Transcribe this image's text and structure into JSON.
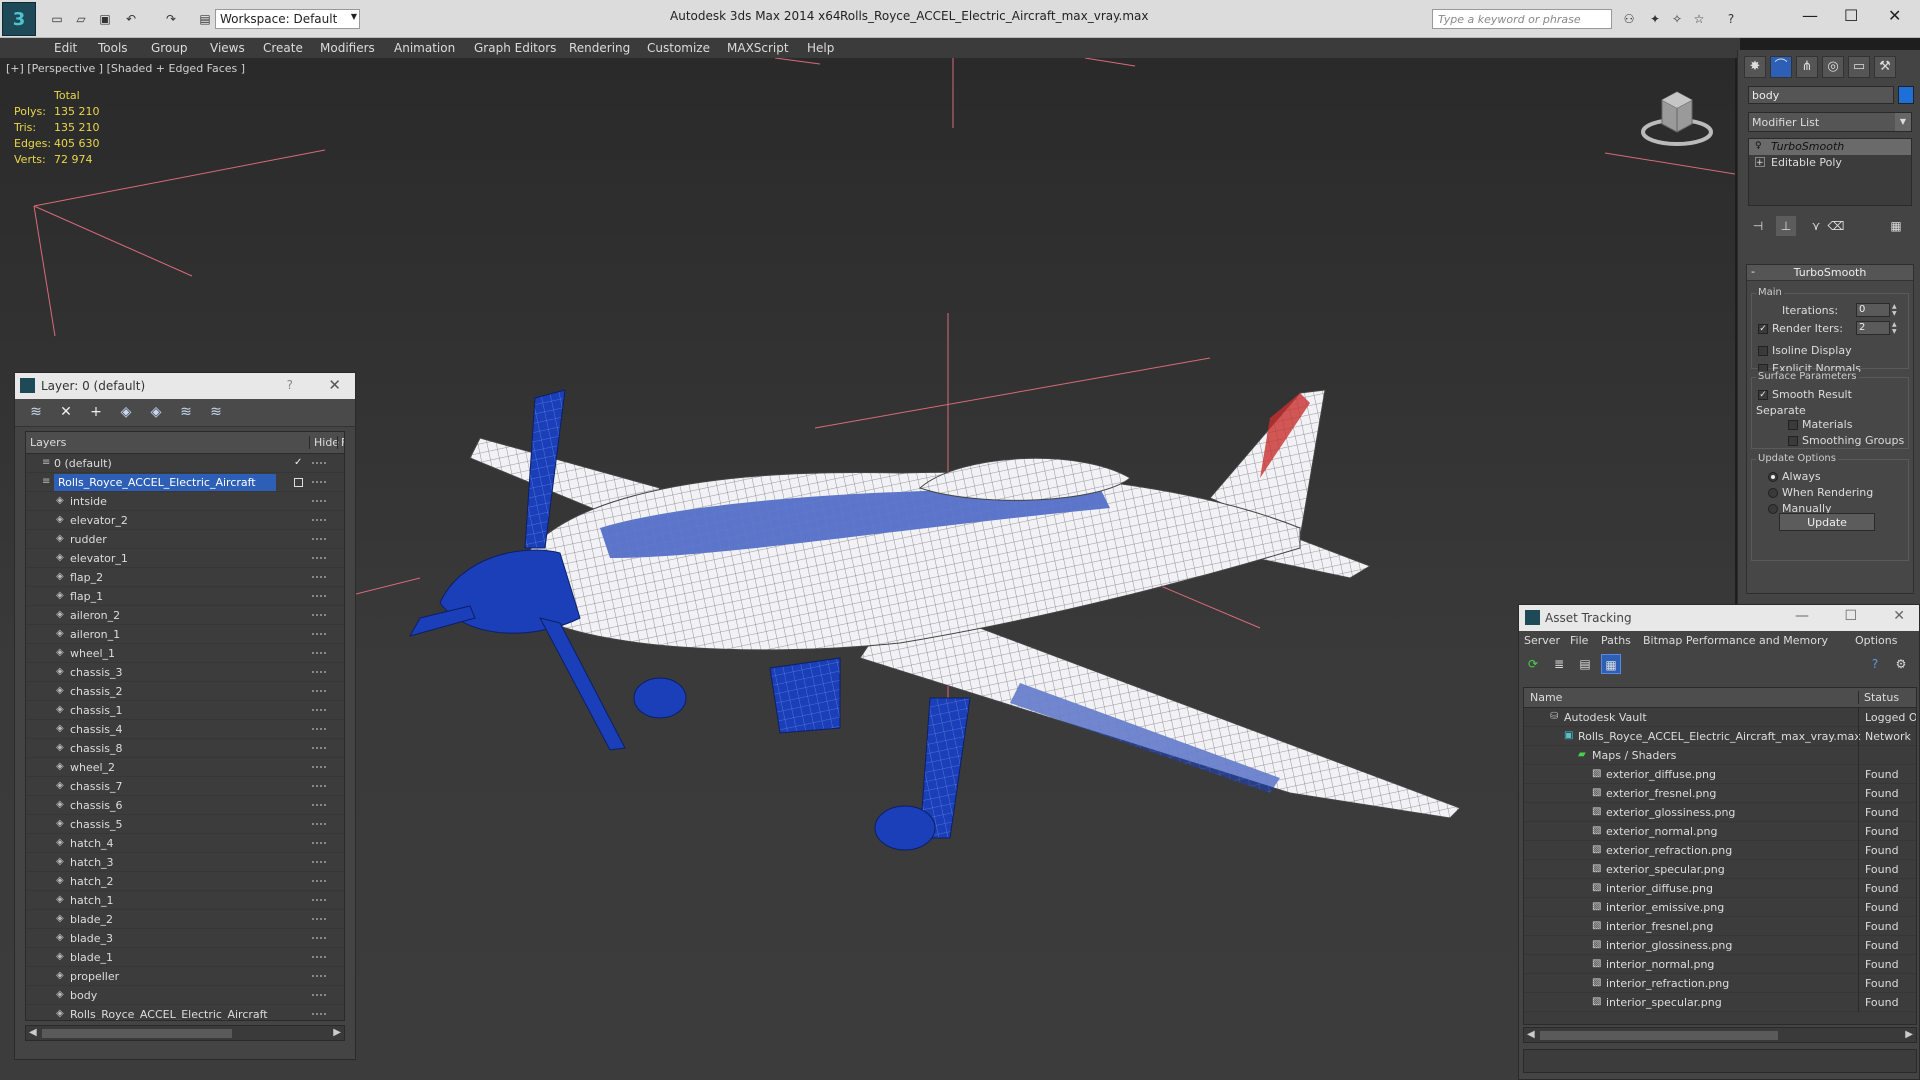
{
  "app": {
    "title": "Autodesk 3ds Max  2014 x64",
    "file_name": "Rolls_Royce_ACCEL_Electric_Aircraft_max_vray.max",
    "workspace": "Workspace: Default",
    "search_placeholder": "Type a keyword or phrase",
    "logo_glyph": "3"
  },
  "menu": [
    "Edit",
    "Tools",
    "Group",
    "Views",
    "Create",
    "Modifiers",
    "Animation",
    "Graph Editors",
    "Rendering",
    "Customize",
    "MAXScript",
    "Help"
  ],
  "viewport": {
    "label": "[+] [Perspective ] [Shaded + Edged Faces ]",
    "stats": {
      "header": "Total",
      "rows": [
        {
          "label": "Polys:",
          "value": "135 210"
        },
        {
          "label": "Tris:",
          "value": "135 210"
        },
        {
          "label": "Edges:",
          "value": "405 630"
        },
        {
          "label": "Verts:",
          "value": "72 974"
        }
      ]
    },
    "colors": {
      "mesh_blue": "#1a3fb8",
      "wire": "#e8e8e8",
      "grid_axis": "#d86a7a",
      "stats": "#e8d84a"
    }
  },
  "layer_window": {
    "title": "Layer: 0 (default)",
    "help": "?",
    "col_layers": "Layers",
    "col_hide": "Hide",
    "col_freeze": "F",
    "rows": [
      {
        "name": "0 (default)",
        "level": 0
      },
      {
        "name": "Rolls_Royce_ACCEL_Electric_Aircraft",
        "level": 0
      },
      {
        "name": "intside",
        "level": 1
      },
      {
        "name": "elevator_2",
        "level": 1
      },
      {
        "name": "rudder",
        "level": 1
      },
      {
        "name": "elevator_1",
        "level": 1
      },
      {
        "name": "flap_2",
        "level": 1
      },
      {
        "name": "flap_1",
        "level": 1
      },
      {
        "name": "aileron_2",
        "level": 1
      },
      {
        "name": "aileron_1",
        "level": 1
      },
      {
        "name": "wheel_1",
        "level": 1
      },
      {
        "name": "chassis_3",
        "level": 1
      },
      {
        "name": "chassis_2",
        "level": 1
      },
      {
        "name": "chassis_1",
        "level": 1
      },
      {
        "name": "chassis_4",
        "level": 1
      },
      {
        "name": "chassis_8",
        "level": 1
      },
      {
        "name": "wheel_2",
        "level": 1
      },
      {
        "name": "chassis_7",
        "level": 1
      },
      {
        "name": "chassis_6",
        "level": 1
      },
      {
        "name": "chassis_5",
        "level": 1
      },
      {
        "name": "hatch_4",
        "level": 1
      },
      {
        "name": "hatch_3",
        "level": 1
      },
      {
        "name": "hatch_2",
        "level": 1
      },
      {
        "name": "hatch_1",
        "level": 1
      },
      {
        "name": "blade_2",
        "level": 1
      },
      {
        "name": "blade_3",
        "level": 1
      },
      {
        "name": "blade_1",
        "level": 1
      },
      {
        "name": "propeller",
        "level": 1
      },
      {
        "name": "body",
        "level": 1
      },
      {
        "name": "Rolls_Royce_ACCEL_Electric_Aircraft",
        "level": 1
      }
    ]
  },
  "command_panel": {
    "object_name": "body",
    "object_color": "#1f6fd8",
    "modifier_list": "Modifier List",
    "stack": [
      "TurboSmooth",
      "Editable Poly"
    ],
    "rollout_title": "TurboSmooth",
    "rollout_toggle": "-",
    "main_group": "Main",
    "iterations_label": "Iterations:",
    "iterations_value": "0",
    "render_iters_label": "Render Iters:",
    "render_iters_value": "2",
    "isoline": "Isoline Display",
    "explicit_normals": "Explicit Normals",
    "surface_group": "Surface Parameters",
    "smooth_result": "Smooth Result",
    "separate": "Separate",
    "materials": "Materials",
    "smoothing_groups": "Smoothing Groups",
    "update_group": "Update Options",
    "always": "Always",
    "when_rendering": "When Rendering",
    "manually": "Manually",
    "update_button": "Update"
  },
  "asset_window": {
    "title": "Asset Tracking",
    "menu": [
      "Server",
      "File",
      "Paths",
      "Bitmap Performance and Memory",
      "Options"
    ],
    "col_name": "Name",
    "col_status": "Status",
    "rows": [
      {
        "name": "Autodesk Vault",
        "status": "Logged Out",
        "level": 0,
        "type": "vault"
      },
      {
        "name": "Rolls_Royce_ACCEL_Electric_Aircraft_max_vray.max",
        "status": "Network",
        "level": 1,
        "type": "max"
      },
      {
        "name": "Maps / Shaders",
        "status": "",
        "level": 2,
        "type": "folder"
      },
      {
        "name": "exterior_diffuse.png",
        "status": "Found",
        "level": 3,
        "type": "file"
      },
      {
        "name": "exterior_fresnel.png",
        "status": "Found",
        "level": 3,
        "type": "file"
      },
      {
        "name": "exterior_glossiness.png",
        "status": "Found",
        "level": 3,
        "type": "file"
      },
      {
        "name": "exterior_normal.png",
        "status": "Found",
        "level": 3,
        "type": "file"
      },
      {
        "name": "exterior_refraction.png",
        "status": "Found",
        "level": 3,
        "type": "file"
      },
      {
        "name": "exterior_specular.png",
        "status": "Found",
        "level": 3,
        "type": "file"
      },
      {
        "name": "interior_diffuse.png",
        "status": "Found",
        "level": 3,
        "type": "file"
      },
      {
        "name": "interior_emissive.png",
        "status": "Found",
        "level": 3,
        "type": "file"
      },
      {
        "name": "interior_fresnel.png",
        "status": "Found",
        "level": 3,
        "type": "file"
      },
      {
        "name": "interior_glossiness.png",
        "status": "Found",
        "level": 3,
        "type": "file"
      },
      {
        "name": "interior_normal.png",
        "status": "Found",
        "level": 3,
        "type": "file"
      },
      {
        "name": "interior_refraction.png",
        "status": "Found",
        "level": 3,
        "type": "file"
      },
      {
        "name": "interior_specular.png",
        "status": "Found",
        "level": 3,
        "type": "file"
      }
    ]
  }
}
